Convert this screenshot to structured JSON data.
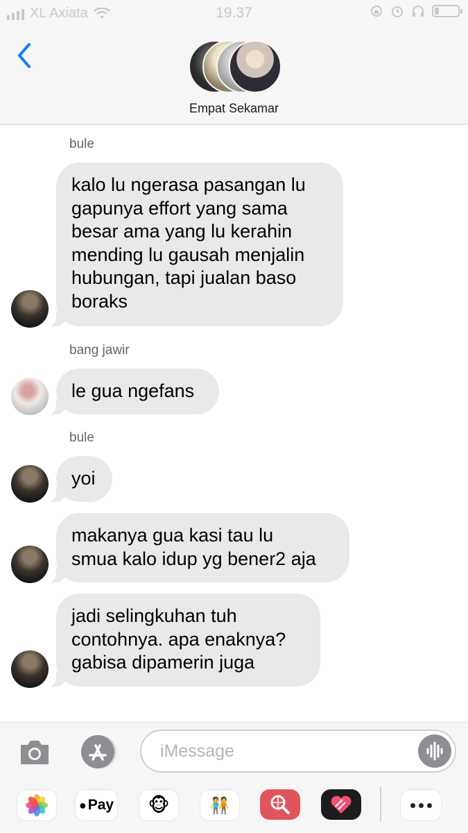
{
  "status_bar": {
    "carrier": "XL Axiata",
    "time": "19.37"
  },
  "header": {
    "group_name": "Empat Sekamar",
    "back_icon": "chevron-left-icon"
  },
  "messages": [
    {
      "sender": "bule",
      "text": "kalo lu ngerasa pasangan lu\ngapunya effort yang sama\nbesar ama yang lu kerahin\nmending lu gausah menjalin\nhubungan, tapi jualan baso\nboraks"
    },
    {
      "sender": "bang jawir",
      "text": "le gua ngefans"
    },
    {
      "sender": "bule",
      "text": "yoi"
    },
    {
      "sender": "",
      "text": "makanya gua kasi tau lu\nsmua kalo idup yg bener2 aja"
    },
    {
      "sender": "",
      "text": "jadi selingkuhan tuh\ncontohnya. apa enaknya?\ngabisa dipamerin juga"
    }
  ],
  "input": {
    "placeholder": "iMessage"
  },
  "app_tray": {
    "items": [
      {
        "name": "photos",
        "icon": "photos-icon"
      },
      {
        "name": "apple-pay",
        "label": "Pay"
      },
      {
        "name": "animoji",
        "icon": "monkey-icon"
      },
      {
        "name": "memoji",
        "icon": "memoji-icon"
      },
      {
        "name": "image-search",
        "icon": "search-globe-icon"
      },
      {
        "name": "heart-app",
        "icon": "heart-icon"
      },
      {
        "name": "more",
        "icon": "more-icon"
      }
    ]
  },
  "colors": {
    "accent": "#1a7cf5",
    "bubble": "#e9e9eb",
    "header_bg": "#f6f6f6"
  }
}
